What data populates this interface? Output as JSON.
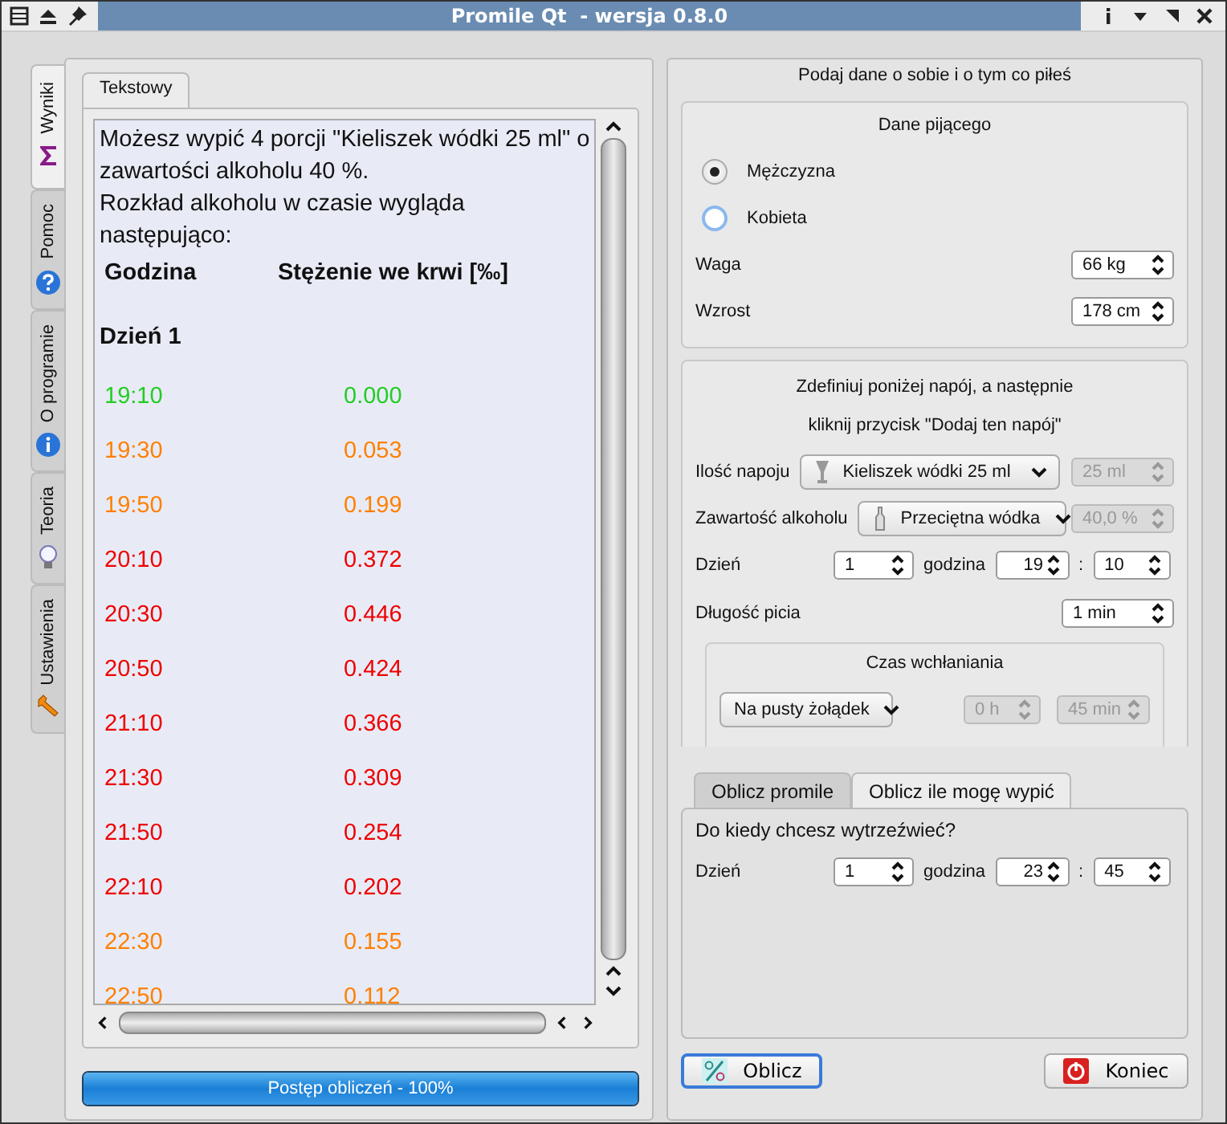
{
  "window": {
    "title": "Promile Qt  - wersja 0.8.0"
  },
  "side_tabs": [
    {
      "label": "Wyniki",
      "selected": true
    },
    {
      "label": "Pomoc",
      "selected": false
    },
    {
      "label": "O programie",
      "selected": false
    },
    {
      "label": "Teoria",
      "selected": false
    },
    {
      "label": "Ustawienia",
      "selected": false
    }
  ],
  "results": {
    "tabs": [
      {
        "label": "Tekstowy",
        "selected": true
      }
    ],
    "paragraphs": [
      "Możesz wypić 4 porcji \"Kieliszek wódki 25 ml\" o zawartości alkoholu 40 %.",
      "Rozkład alkoholu w czasie wygląda następująco:"
    ],
    "headers": [
      "Godzina",
      "Stężenie we krwi [‰]"
    ],
    "day": "Dzień 1",
    "rows": [
      {
        "time": "19:10",
        "value": "0.000",
        "color": "#22cc22"
      },
      {
        "time": "19:30",
        "value": "0.053",
        "color": "#ff7f00"
      },
      {
        "time": "19:50",
        "value": "0.199",
        "color": "#ff7f00"
      },
      {
        "time": "20:10",
        "value": "0.372",
        "color": "#ee0000"
      },
      {
        "time": "20:30",
        "value": "0.446",
        "color": "#ee0000"
      },
      {
        "time": "20:50",
        "value": "0.424",
        "color": "#ee0000"
      },
      {
        "time": "21:10",
        "value": "0.366",
        "color": "#ee0000"
      },
      {
        "time": "21:30",
        "value": "0.309",
        "color": "#ee0000"
      },
      {
        "time": "21:50",
        "value": "0.254",
        "color": "#ee0000"
      },
      {
        "time": "22:10",
        "value": "0.202",
        "color": "#ee0000"
      },
      {
        "time": "22:30",
        "value": "0.155",
        "color": "#ff7f00"
      },
      {
        "time": "22:50",
        "value": "0.112",
        "color": "#ff7f00"
      }
    ]
  },
  "progress": {
    "label": "Postęp obliczeń - 100%",
    "level": 1
  },
  "form": {
    "heading": "Podaj dane o sobie i o tym co piłeś",
    "drinker": {
      "title": "Dane pijącego",
      "gender": [
        {
          "label": "Mężczyzna",
          "selected": true
        },
        {
          "label": "Kobieta",
          "selected": false
        }
      ],
      "fields": [
        {
          "label": "Waga",
          "value": "66 kg"
        },
        {
          "label": "Wzrost",
          "value": "178 cm"
        }
      ]
    },
    "drink": {
      "title": [
        "Zdefiniuj poniżej napój, a następnie",
        "kliknij przycisk \"Dodaj ten napój\""
      ],
      "quantity": {
        "label": "Ilość napoju",
        "combo": "Kieliszek wódki 25 ml",
        "spin": {
          "value": "25 ml",
          "disabled": true
        }
      },
      "alcohol": {
        "label": "Zawartość alkoholu",
        "combo": "Przeciętna wódka",
        "spin": {
          "value": "40,0 %",
          "disabled": true
        }
      },
      "when": {
        "day_label": "Dzień",
        "day": "1",
        "hour_label": "godzina",
        "hour": "19",
        "separator": ":",
        "minute": "10"
      },
      "duration": {
        "label": "Długość picia",
        "value": "1 min"
      },
      "absorption": {
        "title": "Czas wchłaniania",
        "combo": "Na pusty żołądek",
        "spins": [
          {
            "value": "0 h",
            "disabled": true
          },
          {
            "value": "45 min",
            "disabled": true
          }
        ]
      }
    }
  },
  "calc_tabs": [
    {
      "label": "Oblicz promile",
      "selected": false
    },
    {
      "label": "Oblicz ile mogę wypić",
      "selected": true
    }
  ],
  "sober": {
    "question": "Do kiedy chcesz wytrzeźwieć?",
    "when": {
      "day_label": "Dzień",
      "day": "1",
      "hour_label": "godzina",
      "hour": "23",
      "separator": ":",
      "minute": "45"
    }
  },
  "buttons": [
    {
      "label": "Oblicz",
      "default": true
    },
    {
      "label": "Koniec",
      "default": false
    }
  ]
}
